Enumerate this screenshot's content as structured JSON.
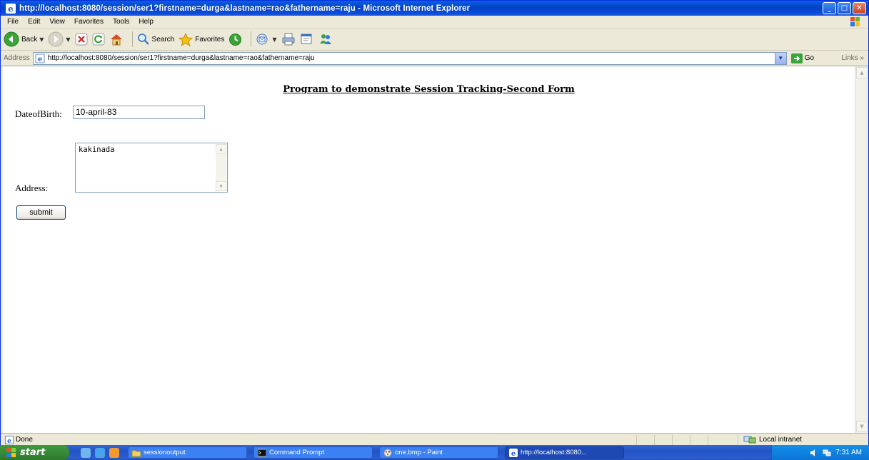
{
  "window": {
    "title": "http://localhost:8080/session/ser1?firstname=durga&lastname=rao&fathername=raju - Microsoft Internet Explorer",
    "controls": {
      "minimize": "_",
      "maximize": "□",
      "close": "✕"
    }
  },
  "menu": [
    "File",
    "Edit",
    "View",
    "Favorites",
    "Tools",
    "Help"
  ],
  "toolbar": {
    "back_label": "Back",
    "search_label": "Search",
    "favorites_label": "Favorites"
  },
  "address": {
    "label": "Address",
    "url": "http://localhost:8080/session/ser1?firstname=durga&lastname=rao&fathername=raju",
    "go_label": "Go",
    "links_label": "Links »"
  },
  "page": {
    "title": "Program to demonstrate Session Tracking-Second Form",
    "dob_label": "DateofBirth:",
    "dob_value": "10-april-83",
    "address_label": "Address:",
    "address_value": "kakinada",
    "submit_label": "submit"
  },
  "status": {
    "text": "Done",
    "zone": "Local intranet"
  },
  "taskbar": {
    "start_label": "start",
    "tasks": [
      {
        "label": "sessionoutput",
        "icon": "folder-icon"
      },
      {
        "label": "Command Prompt",
        "icon": "cmd-icon"
      },
      {
        "label": "one.bmp - Paint",
        "icon": "paint-icon"
      },
      {
        "label": "http://localhost:8080...",
        "icon": "ie-icon"
      }
    ],
    "clock": "7:31 AM"
  },
  "colors": {
    "titlebar": "#0a4ad8",
    "chrome": "#ece9d8",
    "start_button": "#3b8d3b",
    "taskbar": "#2453c4",
    "tray": "#0c74d6"
  }
}
